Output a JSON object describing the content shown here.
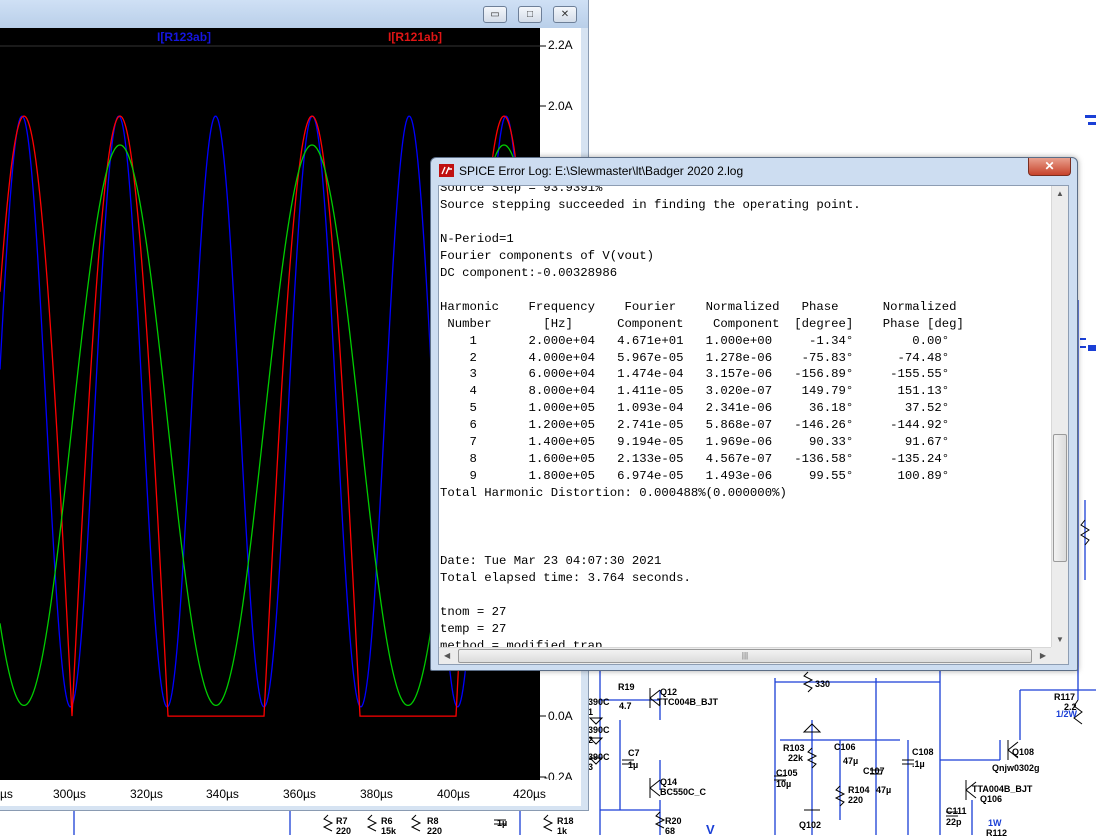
{
  "plot_window": {
    "buttons": {
      "minimize": "▭",
      "restore": "□",
      "close": "✕"
    },
    "traces": [
      {
        "name": "I[R123ab]",
        "color": "#0000ff"
      },
      {
        "name": "I[R121ab]",
        "color": "#ff0000"
      },
      {
        "name": "",
        "color": "#00cc00"
      }
    ],
    "y_axis": {
      "unit": "A",
      "range": [
        -0.2,
        2.2
      ],
      "ticks": [
        "2.2A",
        "2.0A",
        "0.0A",
        "-0.2A"
      ]
    },
    "x_axis": {
      "ticks": [
        "µs",
        "300µs",
        "320µs",
        "340µs",
        "360µs",
        "380µs",
        "400µs",
        "420µs"
      ]
    }
  },
  "log_window": {
    "title": "SPICE Error Log: E:\\Slewmaster\\lt\\Badger 2020 2.log",
    "lines": [
      "Source Step = 93.9391%",
      "Source stepping succeeded in finding the operating point.",
      "",
      "N-Period=1",
      "Fourier components of V(vout)",
      "DC component:-0.00328986",
      "",
      "Harmonic    Frequency    Fourier    Normalized   Phase      Normalized",
      " Number       [Hz]      Component    Component  [degree]    Phase [deg]",
      "    1       2.000e+04   4.671e+01   1.000e+00     -1.34°        0.00°",
      "    2       4.000e+04   5.967e-05   1.278e-06    -75.83°      -74.48°",
      "    3       6.000e+04   1.474e-04   3.157e-06   -156.89°     -155.55°",
      "    4       8.000e+04   1.411e-05   3.020e-07    149.79°      151.13°",
      "    5       1.000e+05   1.093e-04   2.341e-06     36.18°       37.52°",
      "    6       1.200e+05   2.741e-05   5.868e-07   -146.26°     -144.92°",
      "    7       1.400e+05   9.194e-05   1.969e-06     90.33°       91.67°",
      "    8       1.600e+05   2.133e-05   4.567e-07   -136.58°     -135.24°",
      "    9       1.800e+05   6.974e-05   1.493e-06     99.55°      100.89°",
      "Total Harmonic Distortion: 0.000488%(0.000000%)",
      "",
      "",
      "",
      "Date: Tue Mar 23 04:07:30 2021",
      "Total elapsed time: 3.764 seconds.",
      "",
      "tnom = 27",
      "temp = 27",
      "method = modified trap"
    ],
    "scroll": {
      "left_arrow": "◀",
      "right_arrow": "▶",
      "up_arrow": "▲",
      "down_arrow": "▼",
      "grip": "|||"
    }
  },
  "schematic": {
    "labels": [
      "R19",
      "4.7",
      "Q12",
      "TTC004B_BJT",
      "C7",
      "1µ",
      "Q14",
      "BC550C_C",
      "R20",
      "68",
      "R7",
      "220",
      "R6",
      "15k",
      "R8",
      "220",
      "R18",
      "1k",
      "1µ",
      "390C",
      "390C",
      "390C",
      "1",
      "2",
      "3",
      "330",
      "R103",
      "22k",
      "C106",
      "47µ",
      "C105",
      "10µ",
      "C107",
      "47µ",
      "R104",
      "220",
      "Q102",
      "C108",
      ".1µ",
      "C111",
      "22p",
      "TTA004B_BJT",
      "Q106",
      "1W",
      "R112",
      "Q108",
      "Qnjw0302g",
      "R117",
      "2.2",
      "1/2W",
      "V"
    ]
  }
}
